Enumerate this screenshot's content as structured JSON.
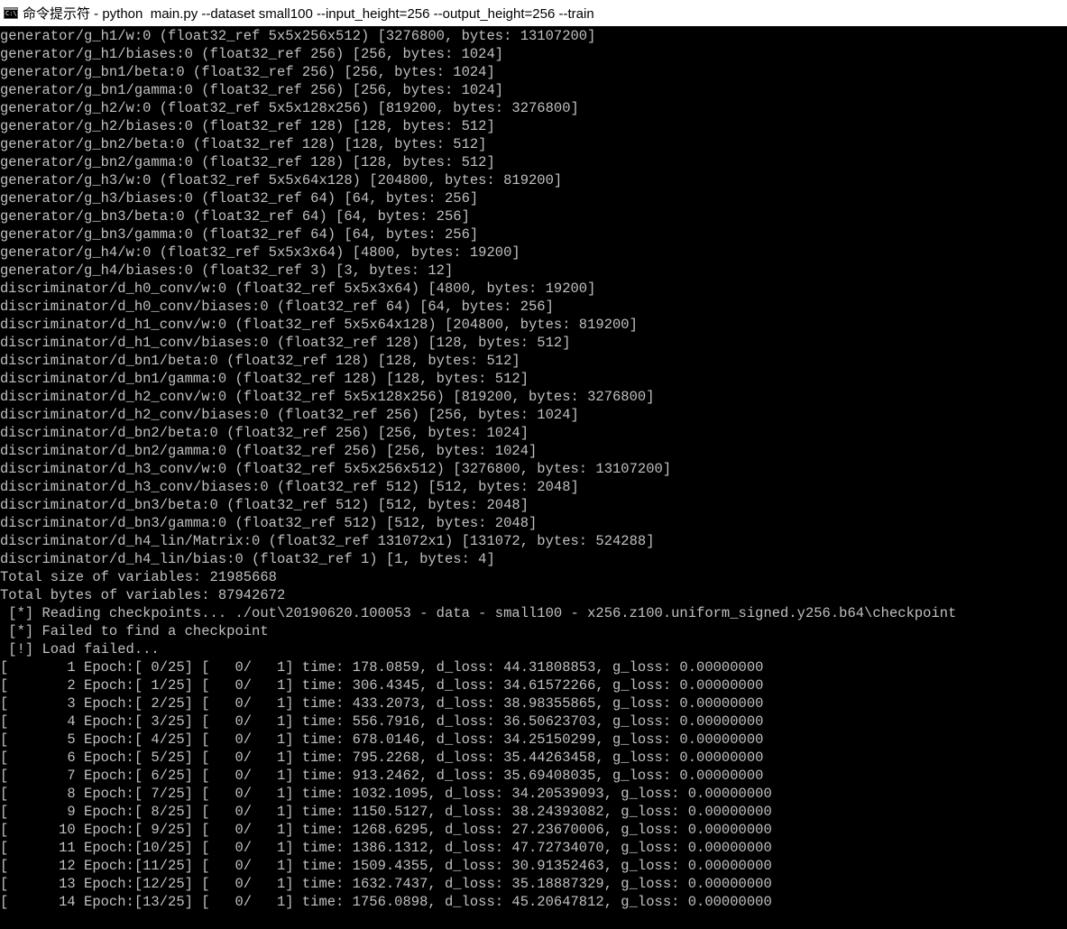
{
  "window": {
    "title": "命令提示符 - python  main.py --dataset small100 --input_height=256 --output_height=256 --train",
    "icon": "cmd-console-icon",
    "icon_text": "C:\\",
    "text_color": "#c0c0c0",
    "background": "#000000"
  },
  "console_lines": [
    "generator/g_h1/w:0 (float32_ref 5x5x256x512) [3276800, bytes: 13107200]",
    "generator/g_h1/biases:0 (float32_ref 256) [256, bytes: 1024]",
    "generator/g_bn1/beta:0 (float32_ref 256) [256, bytes: 1024]",
    "generator/g_bn1/gamma:0 (float32_ref 256) [256, bytes: 1024]",
    "generator/g_h2/w:0 (float32_ref 5x5x128x256) [819200, bytes: 3276800]",
    "generator/g_h2/biases:0 (float32_ref 128) [128, bytes: 512]",
    "generator/g_bn2/beta:0 (float32_ref 128) [128, bytes: 512]",
    "generator/g_bn2/gamma:0 (float32_ref 128) [128, bytes: 512]",
    "generator/g_h3/w:0 (float32_ref 5x5x64x128) [204800, bytes: 819200]",
    "generator/g_h3/biases:0 (float32_ref 64) [64, bytes: 256]",
    "generator/g_bn3/beta:0 (float32_ref 64) [64, bytes: 256]",
    "generator/g_bn3/gamma:0 (float32_ref 64) [64, bytes: 256]",
    "generator/g_h4/w:0 (float32_ref 5x5x3x64) [4800, bytes: 19200]",
    "generator/g_h4/biases:0 (float32_ref 3) [3, bytes: 12]",
    "discriminator/d_h0_conv/w:0 (float32_ref 5x5x3x64) [4800, bytes: 19200]",
    "discriminator/d_h0_conv/biases:0 (float32_ref 64) [64, bytes: 256]",
    "discriminator/d_h1_conv/w:0 (float32_ref 5x5x64x128) [204800, bytes: 819200]",
    "discriminator/d_h1_conv/biases:0 (float32_ref 128) [128, bytes: 512]",
    "discriminator/d_bn1/beta:0 (float32_ref 128) [128, bytes: 512]",
    "discriminator/d_bn1/gamma:0 (float32_ref 128) [128, bytes: 512]",
    "discriminator/d_h2_conv/w:0 (float32_ref 5x5x128x256) [819200, bytes: 3276800]",
    "discriminator/d_h2_conv/biases:0 (float32_ref 256) [256, bytes: 1024]",
    "discriminator/d_bn2/beta:0 (float32_ref 256) [256, bytes: 1024]",
    "discriminator/d_bn2/gamma:0 (float32_ref 256) [256, bytes: 1024]",
    "discriminator/d_h3_conv/w:0 (float32_ref 5x5x256x512) [3276800, bytes: 13107200]",
    "discriminator/d_h3_conv/biases:0 (float32_ref 512) [512, bytes: 2048]",
    "discriminator/d_bn3/beta:0 (float32_ref 512) [512, bytes: 2048]",
    "discriminator/d_bn3/gamma:0 (float32_ref 512) [512, bytes: 2048]",
    "discriminator/d_h4_lin/Matrix:0 (float32_ref 131072x1) [131072, bytes: 524288]",
    "discriminator/d_h4_lin/bias:0 (float32_ref 1) [1, bytes: 4]",
    "Total size of variables: 21985668",
    "Total bytes of variables: 87942672",
    " [*] Reading checkpoints... ./out\\20190620.100053 - data - small100 - x256.z100.uniform_signed.y256.b64\\checkpoint",
    " [*] Failed to find a checkpoint",
    " [!] Load failed...",
    "[       1 Epoch:[ 0/25] [   0/   1] time: 178.0859, d_loss: 44.31808853, g_loss: 0.00000000",
    "[       2 Epoch:[ 1/25] [   0/   1] time: 306.4345, d_loss: 34.61572266, g_loss: 0.00000000",
    "[       3 Epoch:[ 2/25] [   0/   1] time: 433.2073, d_loss: 38.98355865, g_loss: 0.00000000",
    "[       4 Epoch:[ 3/25] [   0/   1] time: 556.7916, d_loss: 36.50623703, g_loss: 0.00000000",
    "[       5 Epoch:[ 4/25] [   0/   1] time: 678.0146, d_loss: 34.25150299, g_loss: 0.00000000",
    "[       6 Epoch:[ 5/25] [   0/   1] time: 795.2268, d_loss: 35.44263458, g_loss: 0.00000000",
    "[       7 Epoch:[ 6/25] [   0/   1] time: 913.2462, d_loss: 35.69408035, g_loss: 0.00000000",
    "[       8 Epoch:[ 7/25] [   0/   1] time: 1032.1095, d_loss: 34.20539093, g_loss: 0.00000000",
    "[       9 Epoch:[ 8/25] [   0/   1] time: 1150.5127, d_loss: 38.24393082, g_loss: 0.00000000",
    "[      10 Epoch:[ 9/25] [   0/   1] time: 1268.6295, d_loss: 27.23670006, g_loss: 0.00000000",
    "[      11 Epoch:[10/25] [   0/   1] time: 1386.1312, d_loss: 47.72734070, g_loss: 0.00000000",
    "[      12 Epoch:[11/25] [   0/   1] time: 1509.4355, d_loss: 30.91352463, g_loss: 0.00000000",
    "[      13 Epoch:[12/25] [   0/   1] time: 1632.7437, d_loss: 35.18887329, g_loss: 0.00000000",
    "[      14 Epoch:[13/25] [   0/   1] time: 1756.0898, d_loss: 45.20647812, g_loss: 0.00000000"
  ]
}
